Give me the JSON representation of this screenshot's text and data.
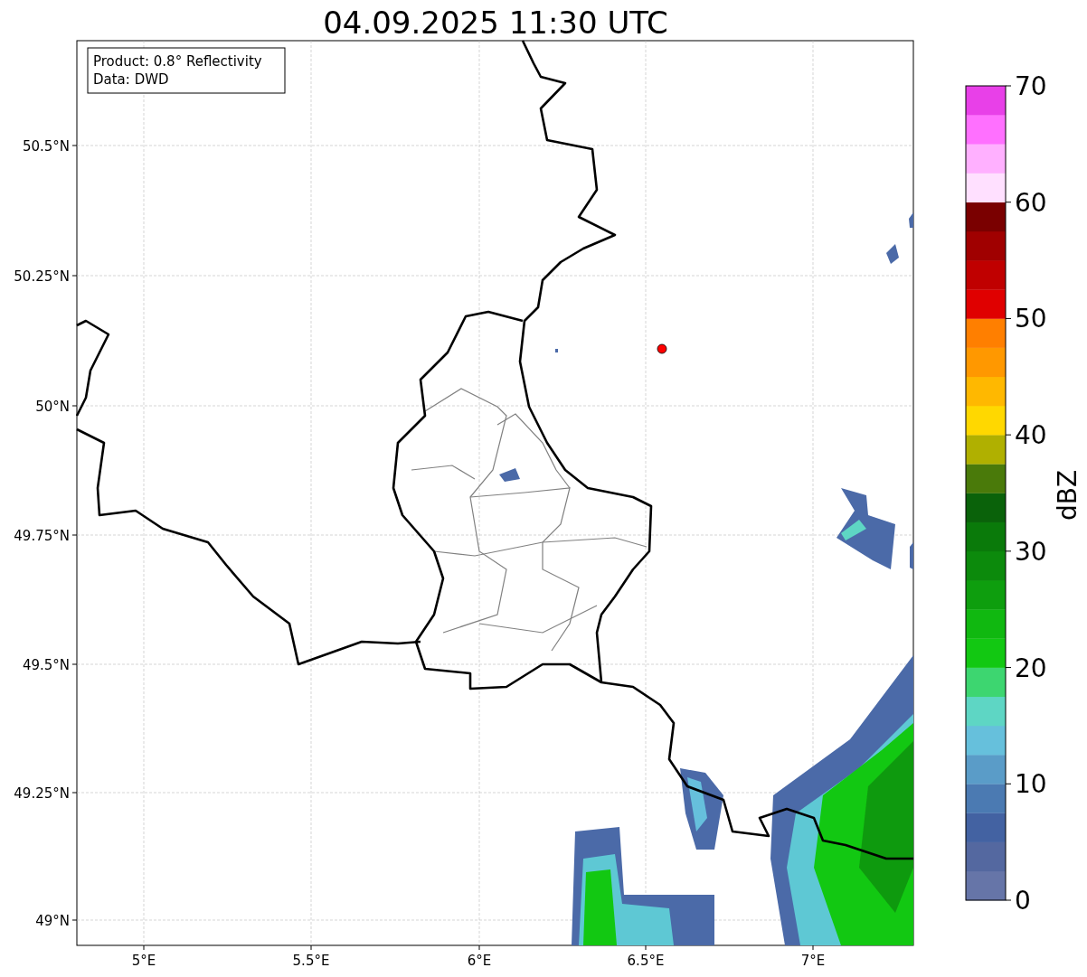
{
  "title": "04.09.2025 11:30 UTC",
  "info_box": {
    "lines": [
      "Product: 0.8° Reflectivity",
      "Data: DWD"
    ]
  },
  "map": {
    "lat_ticks": [
      "50.5°N",
      "50.25°N",
      "50°N",
      "49.75°N",
      "49.5°N",
      "49.25°N",
      "49°N"
    ],
    "lon_ticks": [
      "5°E",
      "5.5°E",
      "6°E",
      "6.5°E",
      "7°E"
    ]
  },
  "colorbar": {
    "label": "dBZ",
    "ticks": [
      "70",
      "60",
      "50",
      "40",
      "30",
      "20",
      "10",
      "0"
    ],
    "segments": [
      {
        "color": "#6675a8"
      },
      {
        "color": "#5468a0"
      },
      {
        "color": "#4362a2"
      },
      {
        "color": "#4b7ab2"
      },
      {
        "color": "#5a9cc8"
      },
      {
        "color": "#66c0dc"
      },
      {
        "color": "#5ed6c4"
      },
      {
        "color": "#3dd670"
      },
      {
        "color": "#12c812"
      },
      {
        "color": "#10b810"
      },
      {
        "color": "#0e9e0e"
      },
      {
        "color": "#0c8a0c"
      },
      {
        "color": "#0a7a0a"
      },
      {
        "color": "#0a620a"
      },
      {
        "color": "#4a7a0a"
      },
      {
        "color": "#b0b000"
      },
      {
        "color": "#ffd800"
      },
      {
        "color": "#ffb800"
      },
      {
        "color": "#ff9800"
      },
      {
        "color": "#ff7f00"
      },
      {
        "color": "#e00000"
      },
      {
        "color": "#c00000"
      },
      {
        "color": "#a00000"
      },
      {
        "color": "#7a0000"
      },
      {
        "color": "#ffe0ff"
      },
      {
        "color": "#ffb0ff"
      },
      {
        "color": "#ff70ff"
      },
      {
        "color": "#e840e8"
      }
    ]
  }
}
